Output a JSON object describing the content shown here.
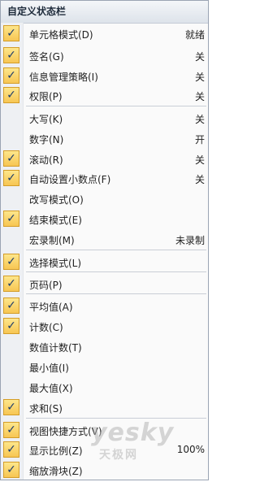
{
  "menu": {
    "title": "自定义状态栏",
    "items": [
      {
        "label": "单元格模式(D)",
        "value": "就绪",
        "checked": true
      },
      {
        "label": "签名(G)",
        "value": "关",
        "checked": true
      },
      {
        "label": "信息管理策略(I)",
        "value": "关",
        "checked": true
      },
      {
        "label": "权限(P)",
        "value": "关",
        "checked": true
      },
      {
        "label": "大写(K)",
        "value": "关",
        "checked": false
      },
      {
        "label": "数字(N)",
        "value": "开",
        "checked": false
      },
      {
        "label": "滚动(R)",
        "value": "关",
        "checked": true
      },
      {
        "label": "自动设置小数点(F)",
        "value": "关",
        "checked": true
      },
      {
        "label": "改写模式(O)",
        "value": "",
        "checked": false
      },
      {
        "label": "结束模式(E)",
        "value": "",
        "checked": true
      },
      {
        "label": "宏录制(M)",
        "value": "未录制",
        "checked": false
      },
      {
        "label": "选择模式(L)",
        "value": "",
        "checked": true
      },
      {
        "label": "页码(P)",
        "value": "",
        "checked": true
      },
      {
        "label": "平均值(A)",
        "value": "",
        "checked": true
      },
      {
        "label": "计数(C)",
        "value": "",
        "checked": true
      },
      {
        "label": "数值计数(T)",
        "value": "",
        "checked": false
      },
      {
        "label": "最小值(I)",
        "value": "",
        "checked": false
      },
      {
        "label": "最大值(X)",
        "value": "",
        "checked": false
      },
      {
        "label": "求和(S)",
        "value": "",
        "checked": true
      },
      {
        "label": "视图快捷方式(V)",
        "value": "",
        "checked": true
      },
      {
        "label": "显示比例(Z)",
        "value": "100%",
        "checked": true
      },
      {
        "label": "缩放滑块(Z)",
        "value": "",
        "checked": true
      }
    ],
    "check_glyph": "✓"
  },
  "watermark": {
    "logo": "yesky",
    "sub": "天极网"
  },
  "colors": {
    "check_fill": "#f7c653",
    "check_border": "#d49d28",
    "check_mark": "#1d3d6b",
    "separator": "#c9ced6"
  }
}
